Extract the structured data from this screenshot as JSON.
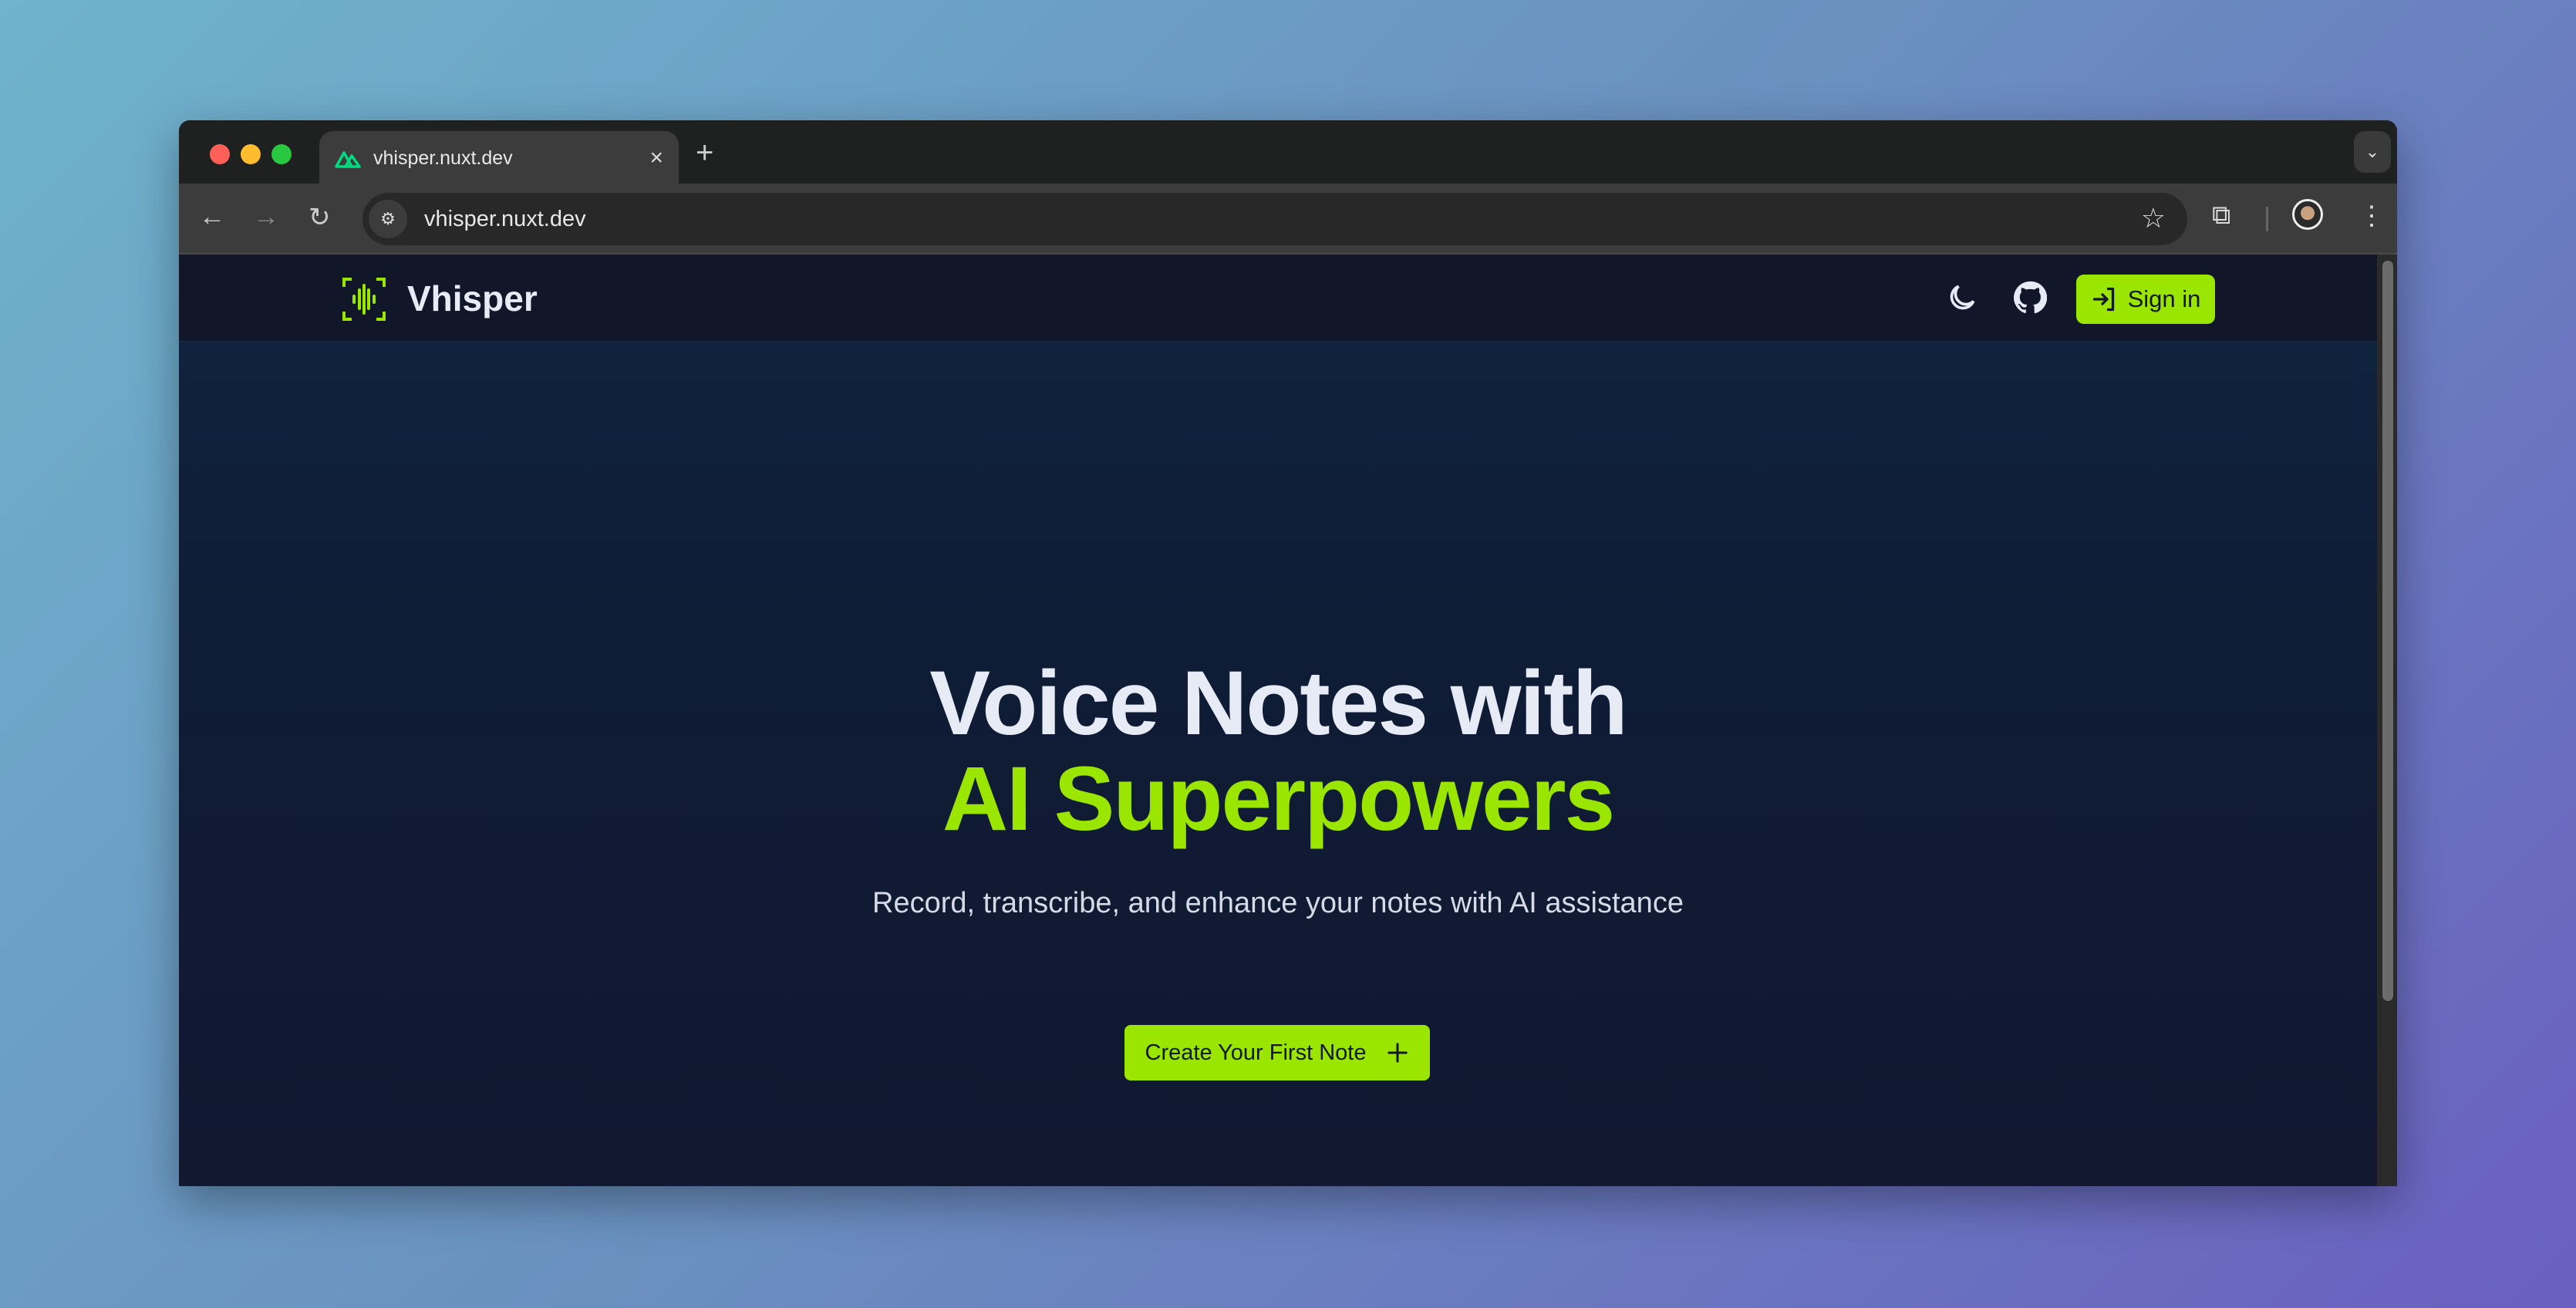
{
  "browser": {
    "tab_title": "vhisper.nuxt.dev",
    "url": "vhisper.nuxt.dev",
    "new_tab": "+",
    "close": "×"
  },
  "nav": {
    "brand": "Vhisper",
    "sign_in": "Sign in"
  },
  "hero": {
    "title_line1": "Voice Notes with",
    "title_line2": "AI Superpowers",
    "subtitle": "Record, transcribe, and enhance your notes with AI assistance",
    "cta": "Create Your First Note"
  },
  "colors": {
    "accent": "#9be600",
    "nav_bg": "#111729",
    "page_bg": "#0f1c36"
  }
}
